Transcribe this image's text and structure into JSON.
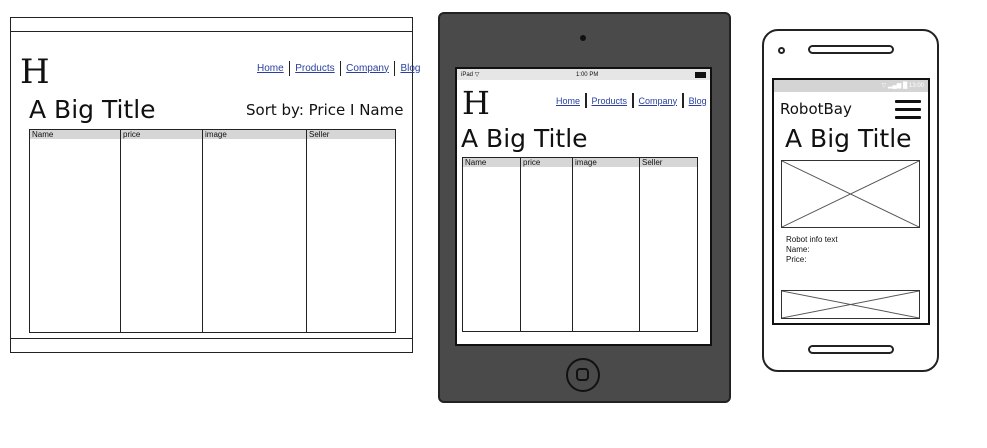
{
  "desktop": {
    "logo": "H",
    "nav": [
      "Home",
      "Products",
      "Company",
      "Blog"
    ],
    "title": "A Big Title",
    "sort_label": "Sort by: Price I Name",
    "table_headers": [
      "Name",
      "price",
      "image",
      "Seller"
    ]
  },
  "tablet": {
    "status_left": "iPad",
    "status_time": "1:00 PM",
    "logo": "H",
    "nav": [
      "Home",
      "Products",
      "Company",
      "Blog"
    ],
    "title": "A Big Title",
    "table_headers": [
      "Name",
      "price",
      "image",
      "Seller"
    ]
  },
  "phone": {
    "status_time": "13:00",
    "brand": "RobotBay",
    "title": "A Big Title",
    "info_text": "Robot info text",
    "name_label": "Name:",
    "price_label": "Price:"
  },
  "colors": {
    "device_body": "#4a4a4a",
    "link": "#2a3f9e",
    "row_stripe": "#ececec",
    "header_fill": "#d6d6d6"
  },
  "icons": [
    "wifi-icon",
    "battery-icon",
    "signal-icon",
    "hamburger-menu-icon",
    "home-button-icon",
    "image-placeholder-icon"
  ]
}
